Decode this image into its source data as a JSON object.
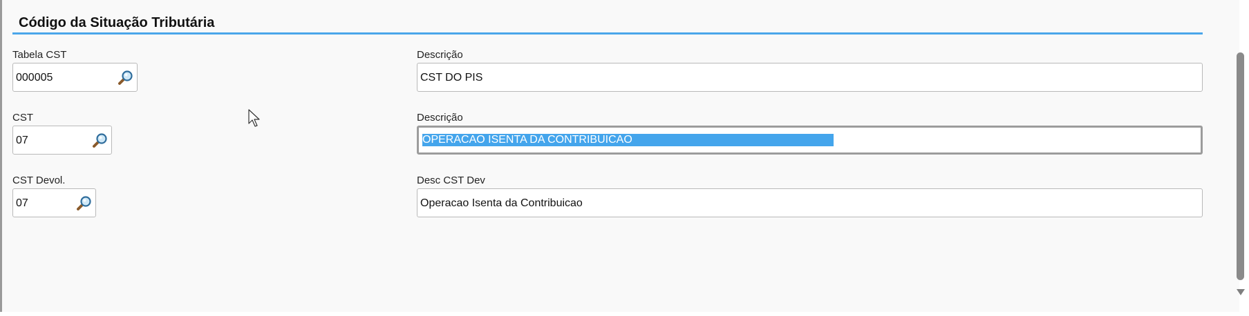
{
  "section": {
    "title": "Código da Situação Tributária"
  },
  "fields": {
    "tabela_cst": {
      "label": "Tabela CST",
      "value": "000005",
      "icon": "search-icon"
    },
    "tabela_desc": {
      "label": "Descrição",
      "value": "CST DO PIS"
    },
    "cst": {
      "label": "CST",
      "value": "07",
      "icon": "search-icon"
    },
    "cst_desc": {
      "label": "Descrição",
      "value": "OPERACAO ISENTA DA CONTRIBUICAO",
      "state": "focused-text-selected"
    },
    "cst_devol": {
      "label": "CST Devol.",
      "value": "07",
      "icon": "search-icon"
    },
    "desc_cst_dev": {
      "label": "Desc CST Dev",
      "value": "Operacao Isenta da Contribuicao"
    }
  },
  "colors": {
    "accent": "#4aa6ea",
    "selection": "#44a5ec",
    "panel_bg": "#f9f9f9"
  },
  "scrollbar": {
    "icon": "scroll-down-arrow-icon"
  }
}
